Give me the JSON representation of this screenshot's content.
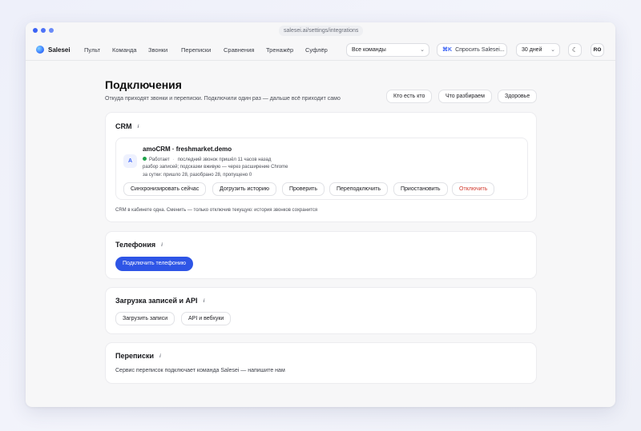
{
  "browser": {
    "url": "salesei.ai/settings/integrations"
  },
  "nav": {
    "brand": "Salesei",
    "items": [
      "Пульт",
      "Команда",
      "Звонки",
      "Переписки",
      "Сравнения",
      "Тренажёр",
      "Суфлёр"
    ],
    "team_select": "Все команды",
    "ask_shortcut": "⌘K",
    "ask_label": "Спросить Salesei...",
    "period_select": "30 дней",
    "theme_icon": "☾",
    "avatar": "RO"
  },
  "page": {
    "title": "Подключения",
    "subtitle": "Откуда приходят звонки и переписки. Подключили один раз — дальше всё приходит само",
    "buttons": [
      "Кто есть кто",
      "Что разбираем",
      "Здоровье"
    ]
  },
  "crm": {
    "title": "CRM",
    "logo_letter": "A",
    "name": "amoCRM · freshmarket.demo",
    "status": "Работает",
    "last_call": "последний звонок пришёл 11 часов назад",
    "mode": "разбор записей; подсказки вживую — через расширение Chrome",
    "stats": "за сутки: пришло 28, разобрано 28, пропущено 0",
    "actions": [
      "Синхронизировать сейчас",
      "Догрузить историю",
      "Проверить",
      "Переподключить",
      "Приостановить",
      "Отключить"
    ],
    "note": "CRM в кабинете одна. Сменить — только отключив текущую: история звонков сохранится"
  },
  "telephony": {
    "title": "Телефония",
    "connect_label": "Подключить телефонию"
  },
  "uploads": {
    "title": "Загрузка записей и API",
    "buttons": [
      "Загрузить записи",
      "API и вебхуки"
    ]
  },
  "chats": {
    "title": "Переписки",
    "text": "Сервис переписок подключает команда Salesei — напишите нам"
  },
  "colors": {
    "accent": "#2e55e6",
    "status_ok": "#1fa24a",
    "danger": "#d13a2e"
  }
}
